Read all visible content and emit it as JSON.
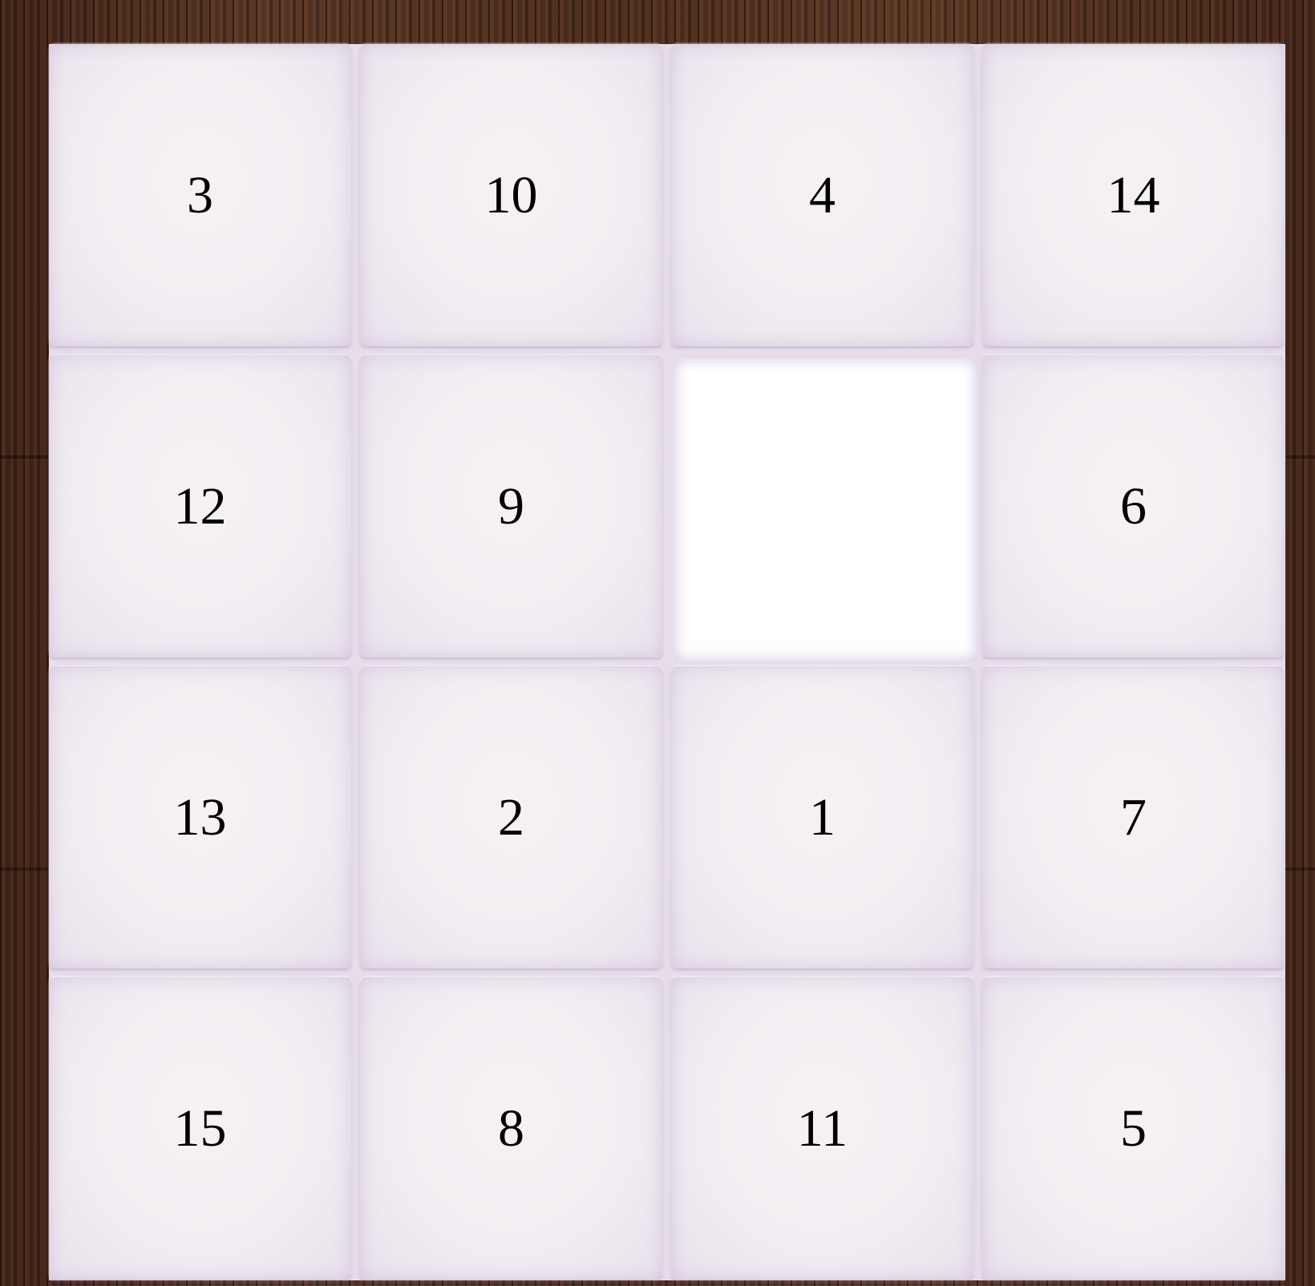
{
  "puzzle": {
    "title": "",
    "grid_size": 4,
    "empty_index": 6,
    "tiles": [
      "3",
      "10",
      "4",
      "14",
      "12",
      "9",
      "",
      "6",
      "13",
      "2",
      "1",
      "7",
      "15",
      "8",
      "11",
      "5"
    ]
  },
  "theme": {
    "tile_color": "#f2eef3",
    "board_color": "#e6dde9",
    "empty_color": "#ffffff",
    "background": "wood"
  }
}
